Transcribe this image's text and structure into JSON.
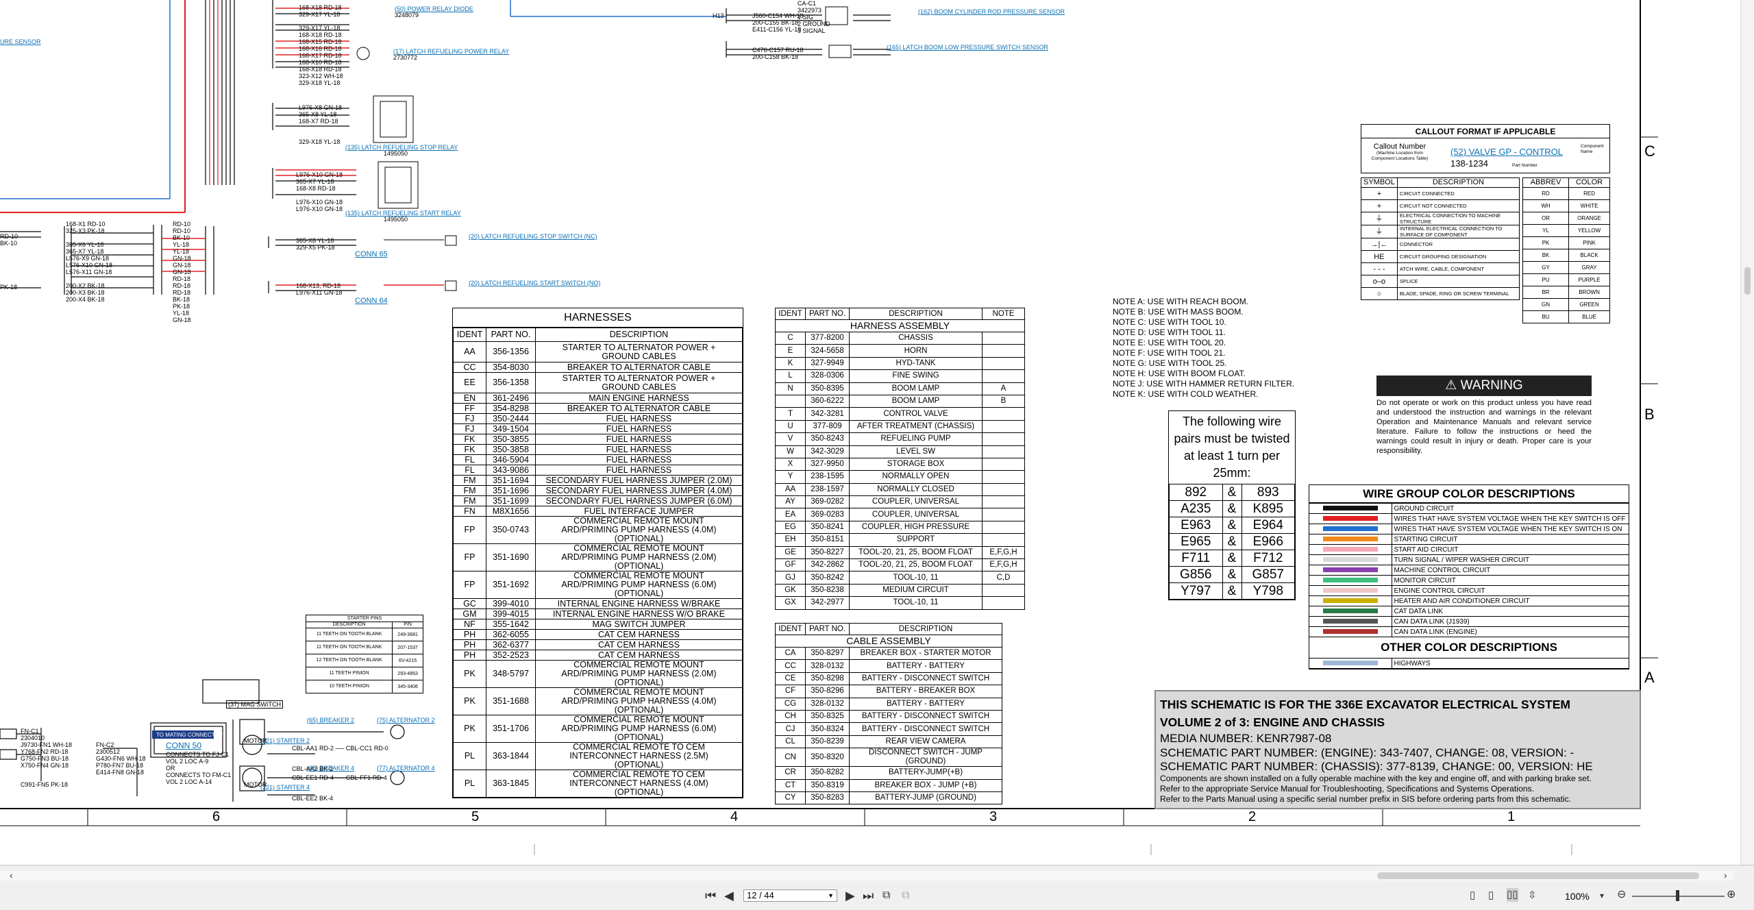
{
  "top_labels": {
    "power_relay_diode": "(50) POWER RELAY DIODE",
    "power_relay_diode_pn": "3248079",
    "latch_refuel_power_relay": "(17) LATCH REFUELING POWER RELAY",
    "latch_refuel_power_relay_pn": "2730772",
    "stop_relay": "(135) LATCH REFUELING STOP RELAY",
    "stop_relay_pn": "1495050",
    "start_relay": "(135) LATCH REFUELING START RELAY",
    "start_relay_pn": "1495050",
    "stop_switch": "(20) LATCH REFUELING STOP SWITCH (NC)",
    "start_switch": "(20) LATCH REFUELING START SWITCH (NO)",
    "conn65": "CONN 65",
    "conn64": "CONN 64",
    "high_pressure": "(162) BOOM CYLINDER ROD PRESSURE SENSOR",
    "low_pressure": "(165) LATCH BOOM LOW PRESSURE SWITCH SENSOR",
    "left_sensor": "URE SENSOR",
    "h13": "H13"
  },
  "callout": {
    "title": "CALLOUT FORMAT IF APPLICABLE",
    "callout_number": "Callout Number",
    "callout_note": "(Machine Location from Component Locations Table)",
    "example": "(52) VALVE GP - CONTROL",
    "component_name": "Component Name",
    "part": "138-1234",
    "part_number": "Part Number"
  },
  "symbols": {
    "headers": [
      "SYMBOL",
      "DESCRIPTION"
    ],
    "rows": [
      {
        "sym": "+",
        "desc": "CIRCUIT CONNECTED"
      },
      {
        "sym": "+",
        "desc": "CIRCUIT NOT CONNECTED"
      },
      {
        "sym": "⏚",
        "desc": "ELECTRICAL CONNECTION TO MACHINE STRUCTURE"
      },
      {
        "sym": "⏚",
        "desc": "INTERNAL ELECTRICAL CONNECTION TO SURFACE OF COMPONENT"
      },
      {
        "sym": "→|←",
        "desc": "CONNECTOR"
      },
      {
        "sym": "HE",
        "desc": "CIRCUIT GROUPING DESIGNATION"
      },
      {
        "sym": "- - -",
        "desc": "ATCH WIRE, CABLE, COMPONENT"
      },
      {
        "sym": "o‒o",
        "desc": "SPLICE"
      },
      {
        "sym": "○",
        "desc": "BLADE, SPADE, RING OR SCREW TERMINAL"
      }
    ]
  },
  "colors": {
    "headers": [
      "ABBREV",
      "COLOR"
    ],
    "rows": [
      [
        "RD",
        "RED"
      ],
      [
        "WH",
        "WHITE"
      ],
      [
        "OR",
        "ORANGE"
      ],
      [
        "YL",
        "YELLOW"
      ],
      [
        "PK",
        "PINK"
      ],
      [
        "BK",
        "BLACK"
      ],
      [
        "GY",
        "GRAY"
      ],
      [
        "PU",
        "PURPLE"
      ],
      [
        "BR",
        "BROWN"
      ],
      [
        "GN",
        "GREEN"
      ],
      [
        "BU",
        "BLUE"
      ]
    ]
  },
  "notes": [
    "NOTE A: USE WITH REACH BOOM.",
    "NOTE B: USE WITH MASS BOOM.",
    "NOTE C: USE WITH TOOL 10.",
    "NOTE D: USE WITH TOOL 11.",
    "NOTE E: USE WITH TOOL 20.",
    "NOTE F: USE WITH TOOL 21.",
    "NOTE G: USE WITH TOOL 25.",
    "NOTE H: USE WITH BOOM FLOAT.",
    "NOTE J: USE WITH HAMMER RETURN FILTER.",
    "NOTE K: USE WITH COLD WEATHER."
  ],
  "warning": {
    "title": "WARNING",
    "text": "Do not operate or work on this product unless you have read and understood the instruction and warnings in the relevant Operation and Maintenance Manuals and relevant service literature. Failure to follow the instructions or heed the warnings could result in injury or death. Proper care is your responsibility."
  },
  "twisted": {
    "title": "The following wire pairs must be twisted at least 1 turn per 25mm:",
    "pairs": [
      [
        "892",
        "893"
      ],
      [
        "A235",
        "K895"
      ],
      [
        "E963",
        "E964"
      ],
      [
        "E965",
        "E966"
      ],
      [
        "F711",
        "F712"
      ],
      [
        "G856",
        "G857"
      ],
      [
        "Y797",
        "Y798"
      ]
    ]
  },
  "wire_groups": {
    "title": "WIRE GROUP COLOR DESCRIPTIONS",
    "rows": [
      {
        "color": "#111111",
        "desc": "GROUND CIRCUIT"
      },
      {
        "color": "#e02020",
        "desc": "WIRES THAT HAVE SYSTEM VOLTAGE WHEN THE KEY SWITCH IS OFF"
      },
      {
        "color": "#1f6fd0",
        "desc": "WIRES THAT HAVE SYSTEM VOLTAGE WHEN THE KEY SWITCH IS ON"
      },
      {
        "color": "#f08a1c",
        "desc": "STARTING CIRCUIT"
      },
      {
        "color": "#f5a8b6",
        "desc": "START AID CIRCUIT"
      },
      {
        "color": "#d9d9d9",
        "desc": "TURN SIGNAL / WIPER WASHER CIRCUIT"
      },
      {
        "color": "#8a3fb0",
        "desc": "MACHINE CONTROL CIRCUIT"
      },
      {
        "color": "#3fbf7f",
        "desc": "MONITOR CIRCUIT"
      },
      {
        "color": "#f0c8c8",
        "desc": "ENGINE CONTROL CIRCUIT"
      },
      {
        "color": "#c9b000",
        "desc": "HEATER AND AIR CONDITIONER CIRCUIT"
      },
      {
        "color": "#2a7a4a",
        "desc": "CAT DATA LINK"
      },
      {
        "color": "#555555",
        "desc": "CAN DATA LINK (J1939)"
      },
      {
        "color": "#b03030",
        "desc": "CAN DATA LINK (ENGINE)"
      }
    ],
    "other_title": "OTHER COLOR DESCRIPTIONS",
    "other": [
      {
        "color": "#9fb8d8",
        "desc": "HIGHWAYS"
      }
    ]
  },
  "title_block": {
    "line1": "THIS SCHEMATIC IS FOR THE 336E EXCAVATOR ELECTRICAL SYSTEM",
    "line2": "VOLUME 2 of 3: ENGINE AND CHASSIS",
    "media": "MEDIA NUMBER: KENR7987-08",
    "part1": "SCHEMATIC PART NUMBER: (ENGINE): 343-7407, CHANGE: 08, VERSION: -",
    "part2": "SCHEMATIC PART NUMBER: (CHASSIS): 377-8139, CHANGE: 00, VERSION: HE",
    "note1": "Components are shown installed on a fully operable machine with the key and engine off, and with parking brake set.",
    "note2": "Refer to the appropriate Service Manual for Troubleshooting, Specifications and Systems Operations.",
    "note3": "Refer to the Parts Manual using a specific serial number prefix in SIS before ordering parts from this schematic."
  },
  "harnesses": {
    "title": "HARNESSES",
    "headers": [
      "IDENT",
      "PART NO.",
      "DESCRIPTION"
    ],
    "rows": [
      [
        "AA",
        "356-1356",
        "STARTER TO ALTERNATOR POWER + GROUND CABLES"
      ],
      [
        "CC",
        "354-8030",
        "BREAKER TO ALTERNATOR CABLE"
      ],
      [
        "EE",
        "356-1358",
        "STARTER TO ALTERNATOR POWER + GROUND CABLES"
      ],
      [
        "EN",
        "361-2496",
        "MAIN ENGINE HARNESS"
      ],
      [
        "FF",
        "354-8298",
        "BREAKER TO ALTERNATOR CABLE"
      ],
      [
        "FJ",
        "350-2444",
        "FUEL HARNESS"
      ],
      [
        "FJ",
        "349-1504",
        "FUEL HARNESS"
      ],
      [
        "FK",
        "350-3855",
        "FUEL HARNESS"
      ],
      [
        "FK",
        "350-3858",
        "FUEL HARNESS"
      ],
      [
        "FL",
        "346-5904",
        "FUEL HARNESS"
      ],
      [
        "FL",
        "343-9086",
        "FUEL HARNESS"
      ],
      [
        "FM",
        "351-1694",
        "SECONDARY FUEL HARNESS JUMPER (2.0M)"
      ],
      [
        "FM",
        "351-1696",
        "SECONDARY FUEL HARNESS JUMPER (4.0M)"
      ],
      [
        "FM",
        "351-1699",
        "SECONDARY FUEL HARNESS JUMPER (6.0M)"
      ],
      [
        "FN",
        "M8X1656",
        "FUEL INTERFACE JUMPER"
      ],
      [
        "FP",
        "350-0743",
        "COMMERCIAL REMOTE MOUNT ARD/PRIMING PUMP HARNESS (4.0M) (OPTIONAL)"
      ],
      [
        "FP",
        "351-1690",
        "COMMERCIAL REMOTE MOUNT ARD/PRIMING PUMP HARNESS (2.0M) (OPTIONAL)"
      ],
      [
        "FP",
        "351-1692",
        "COMMERCIAL REMOTE MOUNT ARD/PRIMING PUMP HARNESS (6.0M) (OPTIONAL)"
      ],
      [
        "GC",
        "399-4010",
        "INTERNAL ENGINE HARNESS W/BRAKE"
      ],
      [
        "GM",
        "399-4015",
        "INTERNAL ENGINE HARNESS W/O BRAKE"
      ],
      [
        "NF",
        "355-1642",
        "MAG SWITCH JUMPER"
      ],
      [
        "PH",
        "362-6055",
        "CAT CEM HARNESS"
      ],
      [
        "PH",
        "362-6377",
        "CAT CEM HARNESS"
      ],
      [
        "PH",
        "352-2523",
        "CAT CEM HARNESS"
      ],
      [
        "PK",
        "348-5797",
        "COMMERCIAL REMOTE MOUNT ARD/PRIMING PUMP HARNESS (2.0M) (OPTIONAL)"
      ],
      [
        "PK",
        "351-1688",
        "COMMERCIAL REMOTE MOUNT ARD/PRIMING PUMP HARNESS (4.0M) (OPTIONAL)"
      ],
      [
        "PK",
        "351-1706",
        "COMMERCIAL REMOTE MOUNT ARD/PRIMING PUMP HARNESS (6.0M) (OPTIONAL)"
      ],
      [
        "PL",
        "363-1844",
        "COMMERCIAL REMOTE TO CEM INTERCONNECT HARNESS (2.5M) (OPTIONAL)"
      ],
      [
        "PL",
        "363-1845",
        "COMMERCIAL REMOTE TO CEM INTERCONNECT HARNESS (4.0M) (OPTIONAL)"
      ]
    ]
  },
  "harness_assembly": {
    "headers": [
      "IDENT",
      "PART NO.",
      "DESCRIPTION",
      "NOTE"
    ],
    "title": "HARNESS ASSEMBLY",
    "rows": [
      [
        "C",
        "377-8200",
        "CHASSIS",
        ""
      ],
      [
        "E",
        "324-5658",
        "HORN",
        ""
      ],
      [
        "K",
        "327-9949",
        "HYD-TANK",
        ""
      ],
      [
        "L",
        "328-0306",
        "FINE SWING",
        ""
      ],
      [
        "N",
        "350-8395",
        "BOOM LAMP",
        "A"
      ],
      [
        "",
        "360-6222",
        "BOOM LAMP",
        "B"
      ],
      [
        "T",
        "342-3281",
        "CONTROL VALVE",
        ""
      ],
      [
        "U",
        "377-809",
        "AFTER TREATMENT (CHASSIS)",
        ""
      ],
      [
        "V",
        "350-8243",
        "REFUELING PUMP",
        ""
      ],
      [
        "W",
        "342-3029",
        "LEVEL SW",
        ""
      ],
      [
        "X",
        "327-9950",
        "STORAGE BOX",
        ""
      ],
      [
        "Y",
        "238-1595",
        "NORMALLY OPEN",
        ""
      ],
      [
        "AA",
        "238-1597",
        "NORMALLY CLOSED",
        ""
      ],
      [
        "AY",
        "369-0282",
        "COUPLER, UNIVERSAL",
        ""
      ],
      [
        "EA",
        "369-0283",
        "COUPLER, UNIVERSAL",
        ""
      ],
      [
        "EG",
        "350-8241",
        "COUPLER, HIGH PRESSURE",
        ""
      ],
      [
        "EH",
        "350-8151",
        "SUPPORT",
        ""
      ],
      [
        "GE",
        "350-8227",
        "TOOL-20, 21, 25, BOOM FLOAT",
        "E,F,G,H"
      ],
      [
        "GF",
        "342-2862",
        "TOOL-20, 21, 25, BOOM FLOAT",
        "E,F,G,H"
      ],
      [
        "GJ",
        "350-8242",
        "TOOL-10, 11",
        "C,D"
      ],
      [
        "GK",
        "350-8238",
        "MEDIUM CIRCUIT",
        ""
      ],
      [
        "GX",
        "342-2977",
        "TOOL-10, 11",
        ""
      ]
    ]
  },
  "cable_assembly": {
    "headers": [
      "IDENT",
      "PART NO.",
      "DESCRIPTION"
    ],
    "title": "CABLE ASSEMBLY",
    "rows": [
      [
        "CA",
        "350-8297",
        "BREAKER BOX - STARTER MOTOR"
      ],
      [
        "CC",
        "328-0132",
        "BATTERY - BATTERY"
      ],
      [
        "CE",
        "350-8298",
        "BATTERY - DISCONNECT SWITCH"
      ],
      [
        "CF",
        "350-8296",
        "BATTERY - BREAKER BOX"
      ],
      [
        "CG",
        "328-0132",
        "BATTERY - BATTERY"
      ],
      [
        "CH",
        "350-8325",
        "BATTERY - DISCONNECT SWITCH"
      ],
      [
        "CJ",
        "350-8324",
        "BATTERY - DISCONNECT SWITCH"
      ],
      [
        "CL",
        "350-8239",
        "REAR VIEW CAMERA"
      ],
      [
        "CN",
        "350-8320",
        "DISCONNECT SWITCH - JUMP (GROUND)"
      ],
      [
        "CR",
        "350-8282",
        "BATTERY-JUMP(+B)"
      ],
      [
        "CT",
        "350-8319",
        "BREAKER BOX - JUMP (+B)"
      ],
      [
        "CY",
        "350-8283",
        "BATTERY-JUMP (GROUND)"
      ]
    ]
  },
  "starter_pins": {
    "title": "STARTER PINS",
    "headers": [
      "DESCRIPTION",
      "P/N"
    ],
    "rows": [
      [
        "11 TEETH ON TOOTH BLANK",
        "249-3681"
      ],
      [
        "11 TEETH ON TOOTH BLANK",
        "207-1537"
      ],
      [
        "12 TEETH ON TOOTH BLANK",
        "6V-4215"
      ],
      [
        "11 TEETH PINION",
        "293-4853"
      ],
      [
        "10 TEETH PINION",
        "345-3406"
      ]
    ]
  },
  "lower_left": {
    "conn50": "CONN 50",
    "mating": "TO MATING CONNECTOR",
    "connects1": "CONNECTS TO FJ-C1",
    "vol1": "VOL 2 LOC A-9",
    "or": "OR",
    "connects2": "CONNECTS TO FM-C1",
    "vol2": "VOL 2 LOC A-14",
    "breaker2": "(65) BREAKER 2",
    "alt2": "(75) ALTERNATOR 2",
    "starter2": "(221) STARTER 2",
    "breaker4": "(65) BREAKER 4",
    "alt4": "(77) ALTERNATOR 4",
    "starter4": "(221) STARTER 4",
    "mag_switch": "(37) MAG SWITCH",
    "motor": "MOTOR"
  },
  "zones_bottom": [
    "6",
    "5",
    "4",
    "3",
    "2",
    "1"
  ],
  "zones_right": [
    "C",
    "B",
    "A"
  ],
  "viewer": {
    "page": "12 / 44",
    "zoom": "100%"
  }
}
